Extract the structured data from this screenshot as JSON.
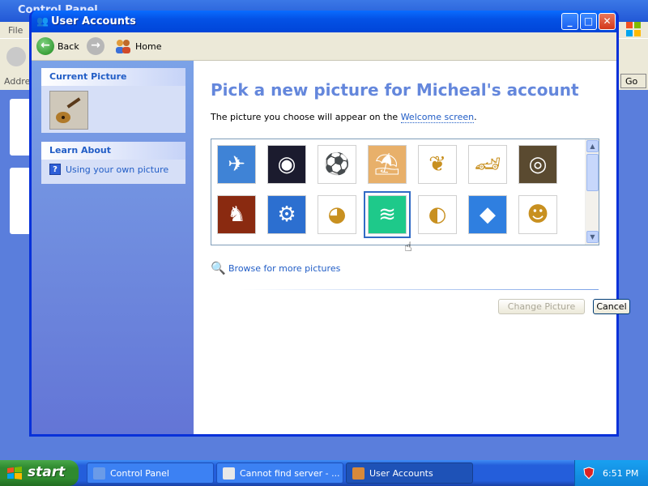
{
  "background_window": {
    "title": "Control Panel",
    "menu_file": "File",
    "address_label": "Addre",
    "go_label": "Go"
  },
  "window": {
    "title": "User Accounts"
  },
  "nav": {
    "back_label": "Back",
    "home_label": "Home"
  },
  "taskpane": {
    "current_picture_heading": "Current Picture",
    "learn_about_heading": "Learn About",
    "learn_link": "Using your own picture"
  },
  "content": {
    "heading": "Pick a new picture for Micheal's account",
    "description_prefix": "The picture you choose will appear on the ",
    "description_link": "Welcome screen",
    "description_suffix": ".",
    "browse_link": "Browse for more pictures",
    "change_button": "Change Picture",
    "cancel_button": "Cancel"
  },
  "pictures": [
    {
      "name": "airplane",
      "glyph": "✈",
      "bg": "#3f83d6"
    },
    {
      "name": "astronaut",
      "glyph": "◉",
      "bg": "#1b1b2e"
    },
    {
      "name": "soccer-ball",
      "glyph": "⚽",
      "bg": "#ffffff"
    },
    {
      "name": "beach-chairs",
      "glyph": "⛱",
      "bg": "#e8b06a"
    },
    {
      "name": "butterfly",
      "glyph": "❦",
      "bg": "#ffffff"
    },
    {
      "name": "race-car",
      "glyph": "🏎",
      "bg": "#ffffff"
    },
    {
      "name": "owl",
      "glyph": "◎",
      "bg": "#5a4a30"
    },
    {
      "name": "chess",
      "glyph": "♞",
      "bg": "#8a2a10"
    },
    {
      "name": "motorcycle",
      "glyph": "⚙",
      "bg": "#2c6fd0"
    },
    {
      "name": "dog",
      "glyph": "◕",
      "bg": "#ffffff"
    },
    {
      "name": "green-scene",
      "glyph": "≋",
      "bg": "#1ec98a"
    },
    {
      "name": "rubber-duck",
      "glyph": "◐",
      "bg": "#ffffff"
    },
    {
      "name": "fish",
      "glyph": "◆",
      "bg": "#2f7fe0"
    },
    {
      "name": "frog",
      "glyph": "☻",
      "bg": "#ffffff"
    }
  ],
  "taskbar": {
    "start_label": "start",
    "tasks": [
      {
        "label": "Control Panel"
      },
      {
        "label": "Cannot find server - ..."
      },
      {
        "label": "User Accounts"
      }
    ],
    "clock": "6:51 PM"
  },
  "colors": {
    "accent": "#215dc6",
    "heading": "#6487dc",
    "title_bar": "#0451e5"
  }
}
